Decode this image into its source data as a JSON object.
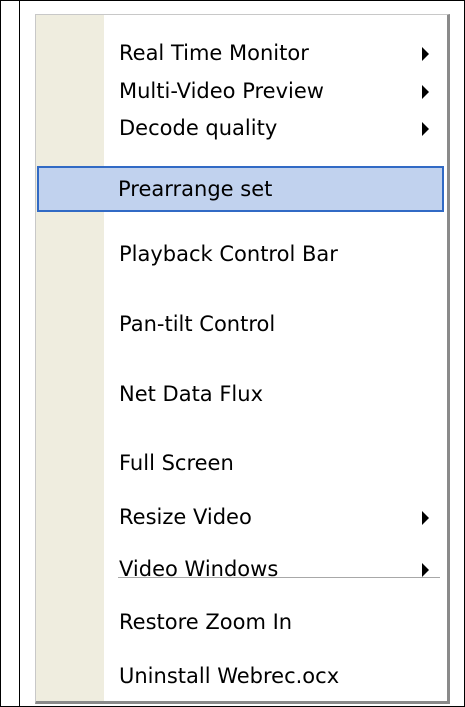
{
  "menu": {
    "items": [
      {
        "label": "Real Time Monitor",
        "submenu": true
      },
      {
        "label": "Multi-Video Preview",
        "submenu": true
      },
      {
        "label": "Decode quality",
        "submenu": true
      },
      {
        "label": "Prearrange set",
        "submenu": false,
        "highlighted": true
      },
      {
        "label": "Playback Control Bar",
        "submenu": false
      },
      {
        "label": "Pan-tilt Control",
        "submenu": false
      },
      {
        "label": "Net Data Flux",
        "submenu": false
      },
      {
        "label": "Full Screen",
        "submenu": false
      },
      {
        "label": "Resize Video",
        "submenu": true
      },
      {
        "label": "Video Windows",
        "submenu": true
      },
      {
        "label": "Restore Zoom In",
        "submenu": false
      },
      {
        "label": "Uninstall Webrec.ocx",
        "submenu": false
      }
    ],
    "highlight_color": "#c1d2ee",
    "highlight_border_color": "#316ac5",
    "gutter_color": "#efeddf",
    "submenu_icon": "submenu-arrow-icon"
  }
}
